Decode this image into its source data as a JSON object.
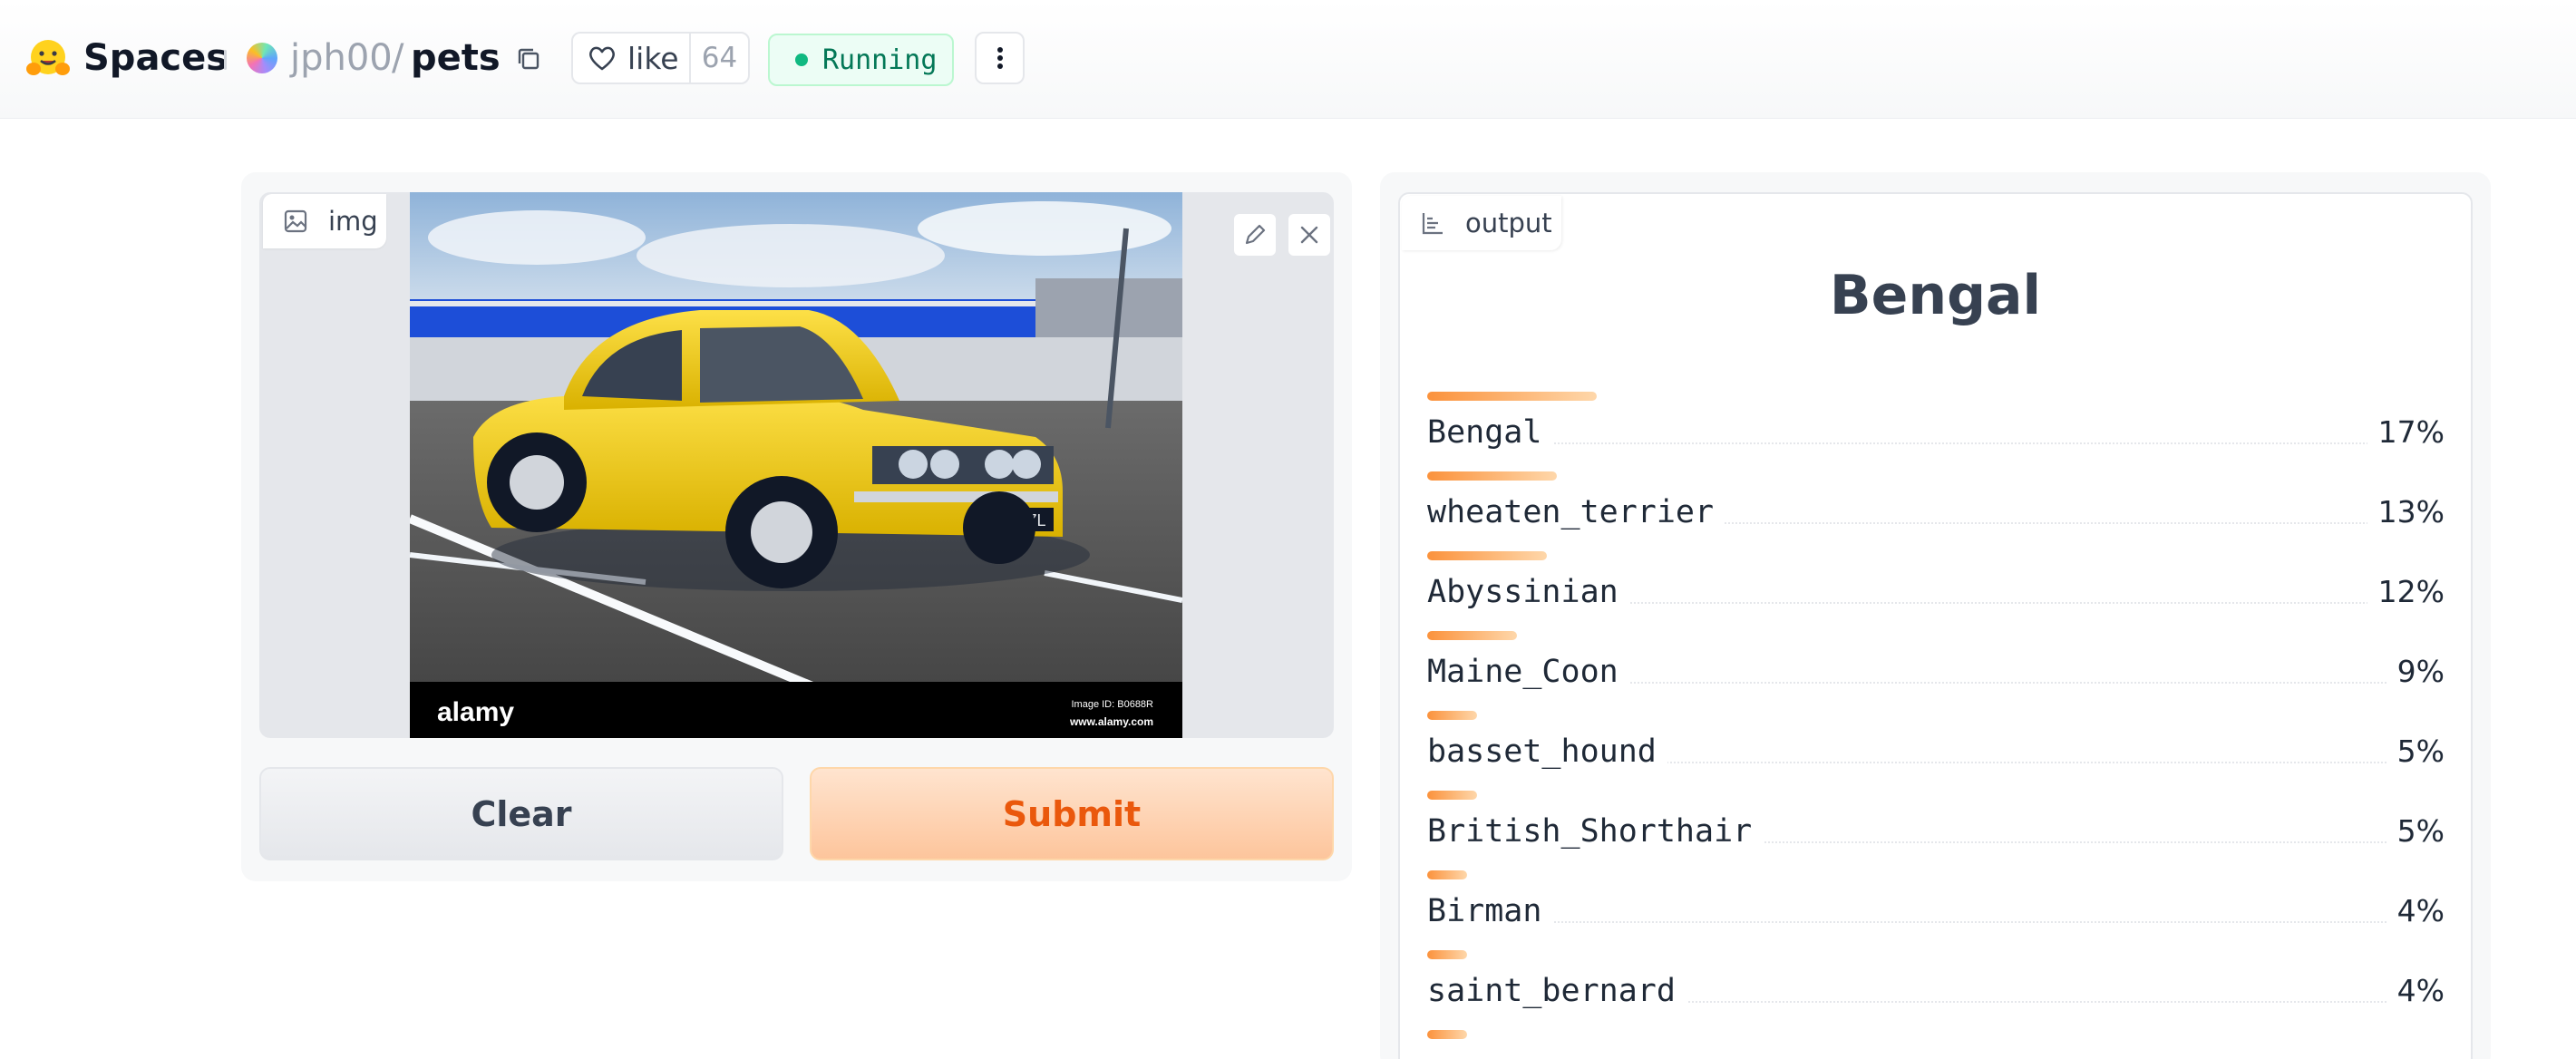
{
  "header": {
    "brand": "Spaces",
    "owner": "jph00",
    "separator": "/",
    "repo": "pets",
    "like_label": "like",
    "like_count": "64",
    "status": "Running"
  },
  "input": {
    "label": "img",
    "clear_label": "Clear",
    "submit_label": "Submit"
  },
  "output": {
    "label": "output",
    "top_label": "Bengal",
    "confidences": [
      {
        "label": "Bengal",
        "percent": "17%",
        "fraction": 0.17
      },
      {
        "label": "wheaten_terrier",
        "percent": "13%",
        "fraction": 0.13
      },
      {
        "label": "Abyssinian",
        "percent": "12%",
        "fraction": 0.12
      },
      {
        "label": "Maine_Coon",
        "percent": "9%",
        "fraction": 0.09
      },
      {
        "label": "basset_hound",
        "percent": "5%",
        "fraction": 0.05
      },
      {
        "label": "British_Shorthair",
        "percent": "5%",
        "fraction": 0.05
      },
      {
        "label": "Birman",
        "percent": "4%",
        "fraction": 0.04
      },
      {
        "label": "saint_bernard",
        "percent": "4%",
        "fraction": 0.04
      },
      {
        "label": "",
        "percent": "",
        "fraction": 0.04
      }
    ]
  },
  "photo_watermarks": {
    "brand": "alamy",
    "image_id": "Image ID: B0688R",
    "site": "www.alamy.com",
    "plate": "LDM 77L"
  },
  "colors": {
    "accent": "#fb923c",
    "submit_text": "#ea580c",
    "running": "#10b981"
  }
}
